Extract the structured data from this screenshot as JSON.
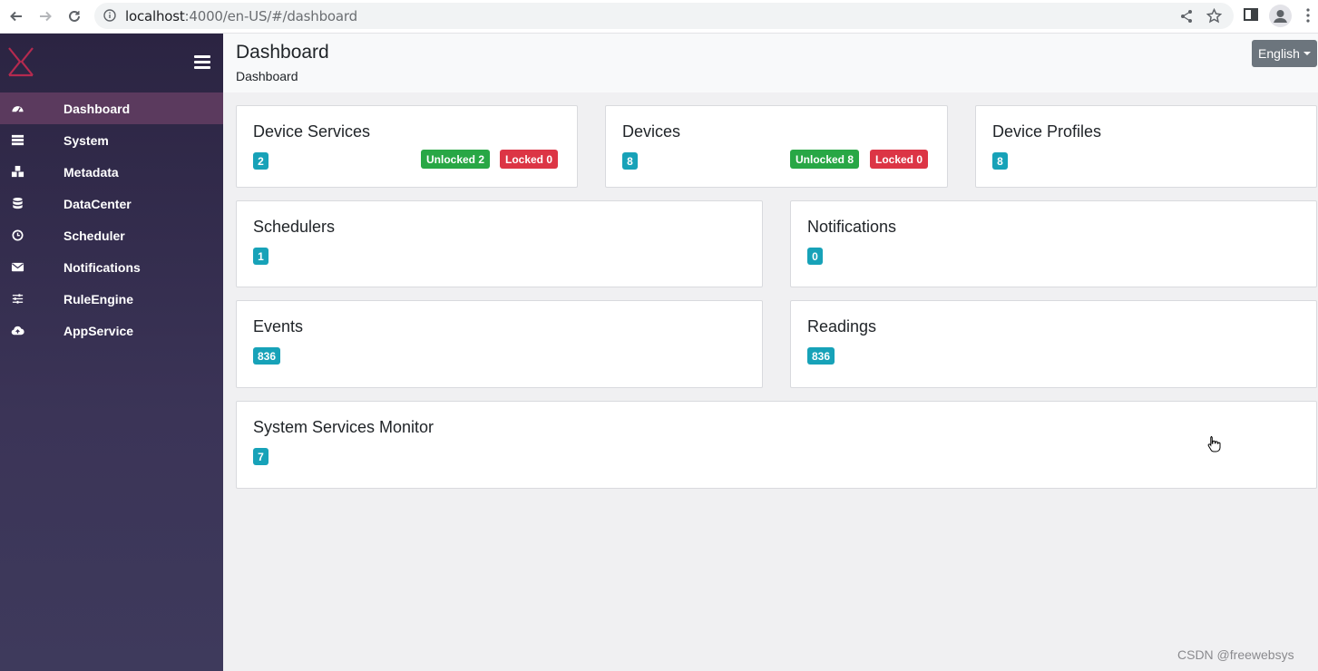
{
  "browser": {
    "url_host": "localhost",
    "url_path": ":4000/en-US/#/dashboard"
  },
  "sidebar": {
    "items": [
      {
        "label": "Dashboard",
        "icon": "tachometer-icon",
        "active": true
      },
      {
        "label": "System",
        "icon": "server-icon",
        "active": false
      },
      {
        "label": "Metadata",
        "icon": "cubes-icon",
        "active": false
      },
      {
        "label": "DataCenter",
        "icon": "database-icon",
        "active": false
      },
      {
        "label": "Scheduler",
        "icon": "clock-icon",
        "active": false
      },
      {
        "label": "Notifications",
        "icon": "envelope-icon",
        "active": false
      },
      {
        "label": "RuleEngine",
        "icon": "sliders-icon",
        "active": false
      },
      {
        "label": "AppService",
        "icon": "cloud-upload-icon",
        "active": false
      }
    ]
  },
  "header": {
    "title": "Dashboard",
    "breadcrumb": "Dashboard",
    "language": "English"
  },
  "cards": {
    "device_services": {
      "title": "Device Services",
      "count": "2",
      "unlocked": "Unlocked 2",
      "locked": "Locked 0"
    },
    "devices": {
      "title": "Devices",
      "count": "8",
      "unlocked": "Unlocked 8",
      "locked": "Locked 0"
    },
    "device_profiles": {
      "title": "Device Profiles",
      "count": "8"
    },
    "schedulers": {
      "title": "Schedulers",
      "count": "1"
    },
    "notifications": {
      "title": "Notifications",
      "count": "0"
    },
    "events": {
      "title": "Events",
      "count": "836"
    },
    "readings": {
      "title": "Readings",
      "count": "836"
    },
    "system_services_monitor": {
      "title": "System Services Monitor",
      "count": "7"
    }
  },
  "watermark": "CSDN @freewebsys",
  "colors": {
    "sidebar_bg": "#2b2442",
    "active_item": "#5b3a5e",
    "count_badge": "#17a2b8",
    "unlocked": "#28a745",
    "locked": "#dc3545",
    "lang_button": "#6c757d"
  }
}
